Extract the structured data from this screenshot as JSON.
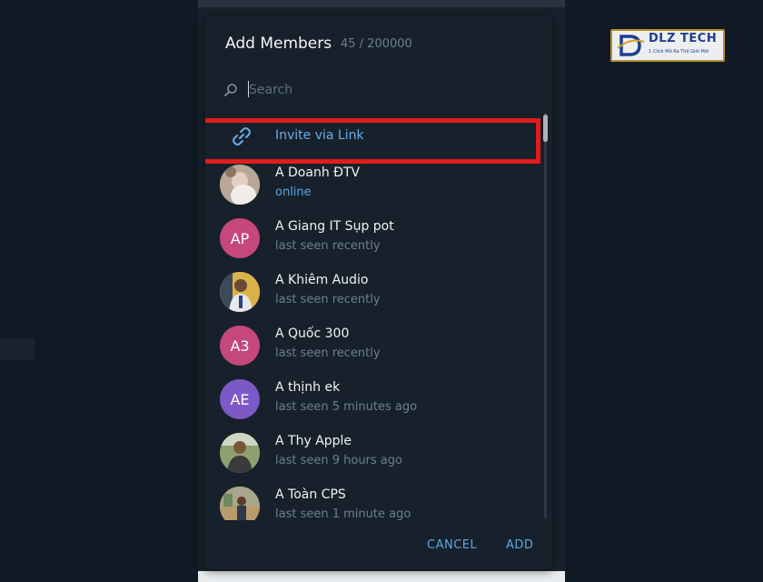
{
  "dialog": {
    "title": "Add Members",
    "count": "45 / 200000"
  },
  "search": {
    "placeholder": "Search",
    "value": ""
  },
  "invite": {
    "label": "Invite via Link",
    "icon": "link-icon"
  },
  "members": [
    {
      "name": "A Doanh ĐTV",
      "status": "online",
      "avatar_type": "photo",
      "color": "#c9b9a8"
    },
    {
      "name": "A Giang IT Sụp pot",
      "status": "last seen recently",
      "avatar_type": "initials",
      "initials": "AP",
      "color": "#c5487d"
    },
    {
      "name": "A Khiêm Audio",
      "status": "last seen recently",
      "avatar_type": "photo",
      "color": "#c8a040"
    },
    {
      "name": "A Quốc 300",
      "status": "last seen recently",
      "avatar_type": "initials",
      "initials": "A3",
      "color": "#c5487d"
    },
    {
      "name": "A thịnh ek",
      "status": "last seen 5 minutes ago",
      "avatar_type": "initials",
      "initials": "AE",
      "color": "#7b5ac8"
    },
    {
      "name": "A Thy Apple",
      "status": "last seen 9 hours ago",
      "avatar_type": "photo",
      "color": "#6f7f5a"
    },
    {
      "name": "A Toàn CPS",
      "status": "last seen 1 minute ago",
      "avatar_type": "photo",
      "color": "#8a8a70"
    }
  ],
  "footer": {
    "cancel_label": "CANCEL",
    "add_label": "ADD"
  },
  "logo": {
    "text": "DLZ TECH",
    "tagline": "1 Click Mở Ra Thế Giới Mới"
  },
  "colors": {
    "accent": "#5aa8e6",
    "highlight": "#e01c1c",
    "background": "#17212b"
  }
}
